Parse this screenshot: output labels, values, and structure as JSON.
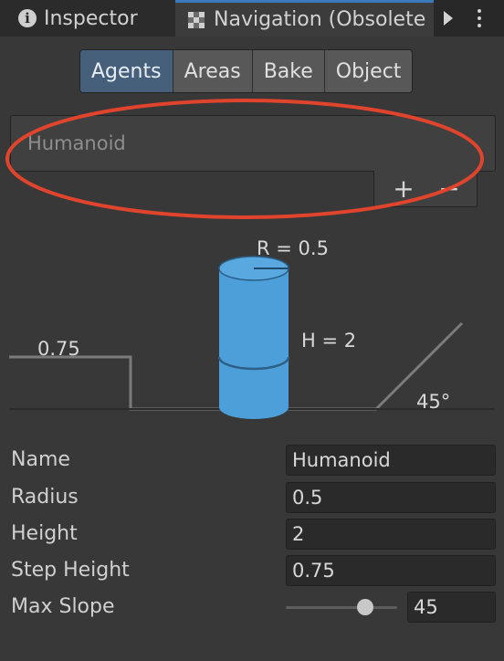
{
  "tabs": [
    {
      "label": "Inspector",
      "icon": "info-icon"
    },
    {
      "label": "Navigation (Obsolete",
      "icon": "navigation-icon"
    }
  ],
  "toolbar": {
    "buttons": [
      "Agents",
      "Areas",
      "Bake",
      "Object"
    ],
    "active": "Agents"
  },
  "agent_list": {
    "items": [
      "Humanoid"
    ],
    "add_label": "+",
    "remove_label": "−"
  },
  "diagram": {
    "radius_label": "R = 0.5",
    "height_label": "H = 2",
    "step_label": "0.75",
    "slope_label": "45°"
  },
  "properties": {
    "name": {
      "label": "Name",
      "value": "Humanoid"
    },
    "radius": {
      "label": "Radius",
      "value": "0.5"
    },
    "height": {
      "label": "Height",
      "value": "2"
    },
    "step_height": {
      "label": "Step Height",
      "value": "0.75"
    },
    "max_slope": {
      "label": "Max Slope",
      "value": "45"
    }
  },
  "colors": {
    "accent": "#46607c",
    "agent_cylinder": "#4c9fd9",
    "highlight": "#e0442c"
  }
}
